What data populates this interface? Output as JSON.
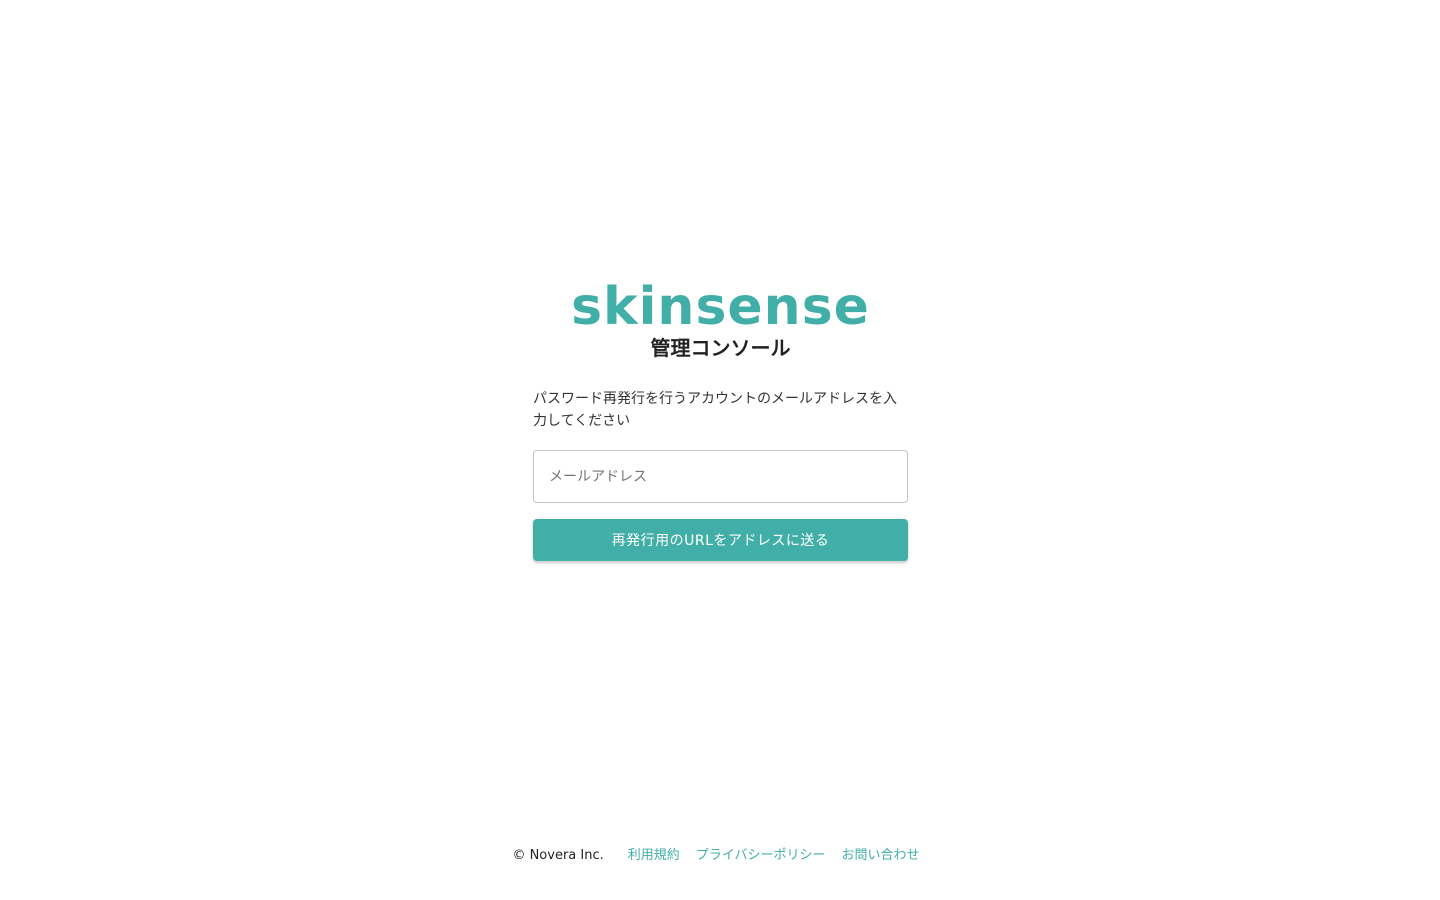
{
  "brand": {
    "logo_text": "skinsense",
    "subtitle": "管理コンソール",
    "accent_color": "#41afa8"
  },
  "form": {
    "instruction": "パスワード再発行を行うアカウントのメールアドレスを入力してください",
    "email_placeholder": "メールアドレス",
    "email_value": "",
    "submit_label": "再発行用のURLをアドレスに送る"
  },
  "footer": {
    "copyright": "© Novera Inc.",
    "links": [
      {
        "label": "利用規約"
      },
      {
        "label": "プライバシーポリシー"
      },
      {
        "label": "お問い合わせ"
      }
    ]
  }
}
